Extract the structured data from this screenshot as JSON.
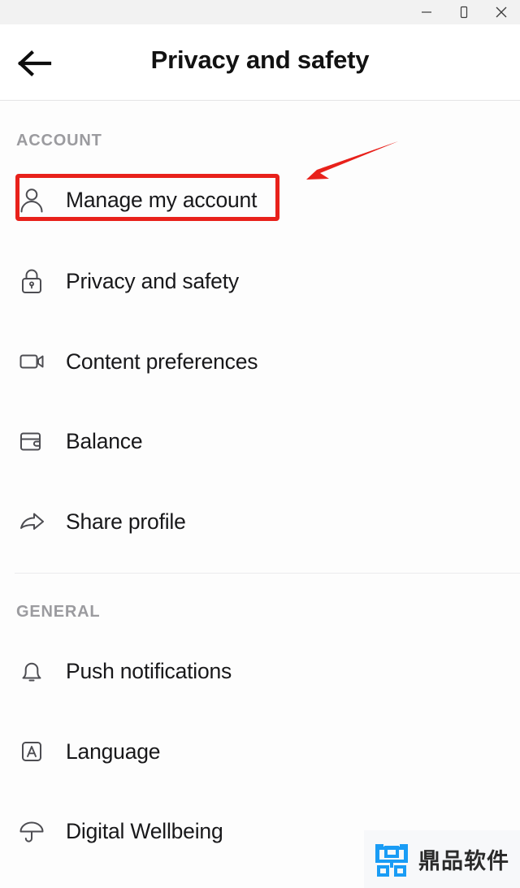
{
  "window": {
    "controls": [
      {
        "name": "minimize-button",
        "label": "—",
        "icon": "minimize-icon"
      },
      {
        "name": "maximize-button",
        "label": "☐",
        "icon": "maximize-icon"
      },
      {
        "name": "close-button",
        "label": "✕",
        "icon": "close-icon"
      }
    ]
  },
  "header": {
    "title": "Privacy and safety",
    "back_icon": "arrow-left-icon"
  },
  "sections": [
    {
      "id": "account",
      "label": "ACCOUNT",
      "items": [
        {
          "id": "manage-my-account",
          "label": "Manage my account",
          "icon": "person-icon",
          "highlighted": true
        },
        {
          "id": "privacy-and-safety",
          "label": "Privacy and safety",
          "icon": "lock-icon",
          "highlighted": false
        },
        {
          "id": "content-preferences",
          "label": "Content preferences",
          "icon": "video-camera-icon",
          "highlighted": false
        },
        {
          "id": "balance",
          "label": "Balance",
          "icon": "wallet-icon",
          "highlighted": false
        },
        {
          "id": "share-profile",
          "label": "Share profile",
          "icon": "share-arrow-icon",
          "highlighted": false
        }
      ]
    },
    {
      "id": "general",
      "label": "GENERAL",
      "items": [
        {
          "id": "push-notifications",
          "label": "Push notifications",
          "icon": "bell-icon",
          "highlighted": false
        },
        {
          "id": "language",
          "label": "Language",
          "icon": "letter-a-box-icon",
          "highlighted": false
        },
        {
          "id": "digital-wellbeing",
          "label": "Digital Wellbeing",
          "icon": "umbrella-icon",
          "highlighted": false
        }
      ]
    }
  ],
  "annotation": {
    "highlight_color": "#e8211b",
    "arrow_color": "#e8211b",
    "target": "Manage my account"
  },
  "watermark": {
    "text": "鼎品软件",
    "logo_icon": "ding-pin-logo-icon",
    "logo_color": "#1a9cf5"
  },
  "colors": {
    "titlebar_bg": "#f2f2f2",
    "content_bg": "#fdfdfd",
    "section_label": "#9b9b9f",
    "item_label": "#18181a",
    "divider": "#ebebed"
  }
}
